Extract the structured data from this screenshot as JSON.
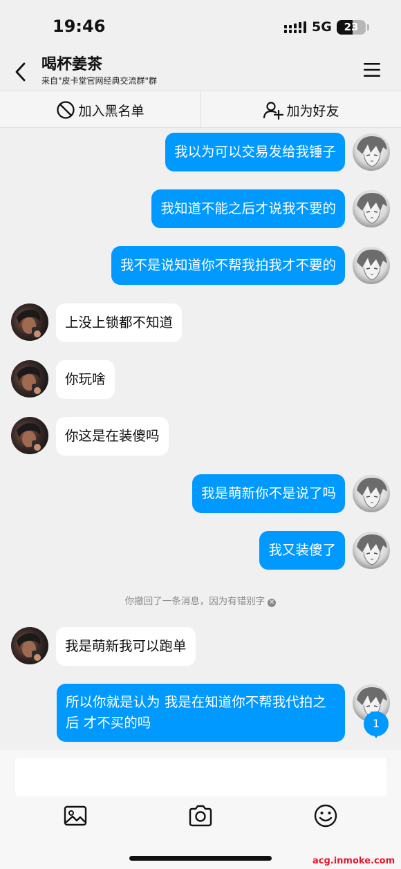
{
  "status_bar": {
    "time": "19:46",
    "network": "5G",
    "battery": "23"
  },
  "header": {
    "title": "喝杯姜茶",
    "subtitle": "来自\"皮卡堂官网经典交流群\"群"
  },
  "actions": {
    "blacklist": "加入黑名单",
    "add_friend": "加为好友"
  },
  "messages": [
    {
      "side": "out",
      "text": "我以为可以交易发给我锤子"
    },
    {
      "side": "out",
      "text": "我知道不能之后才说我不要的"
    },
    {
      "side": "out",
      "text": "我不是说知道你不帮我拍我才不要的"
    },
    {
      "side": "in",
      "text": "上没上锁都不知道"
    },
    {
      "side": "in",
      "text": "你玩啥"
    },
    {
      "side": "in",
      "text": "你这是在装傻吗"
    },
    {
      "side": "out",
      "text": "我是萌新你不是说了吗"
    },
    {
      "side": "out",
      "text": "我又装傻了"
    },
    {
      "side": "in",
      "text": "我是萌新我可以跑单"
    },
    {
      "side": "out",
      "text": "所以你就是认为 我是在知道你不帮我代拍之后 才不买的吗"
    }
  ],
  "notice": "你撤回了一条消息，因为有错别字",
  "unread_count": "1",
  "input": {
    "value": "",
    "placeholder": ""
  },
  "icons": [
    "back-arrow-icon",
    "menu-icon",
    "block-icon",
    "add-user-icon",
    "image-icon",
    "camera-icon",
    "emoji-icon"
  ],
  "colors": {
    "accent": "#0099ff",
    "background": "#f0f0f0",
    "bubble_in": "#ffffff",
    "watermark": "#e8162e"
  },
  "watermark": "acg.inmoke.com"
}
